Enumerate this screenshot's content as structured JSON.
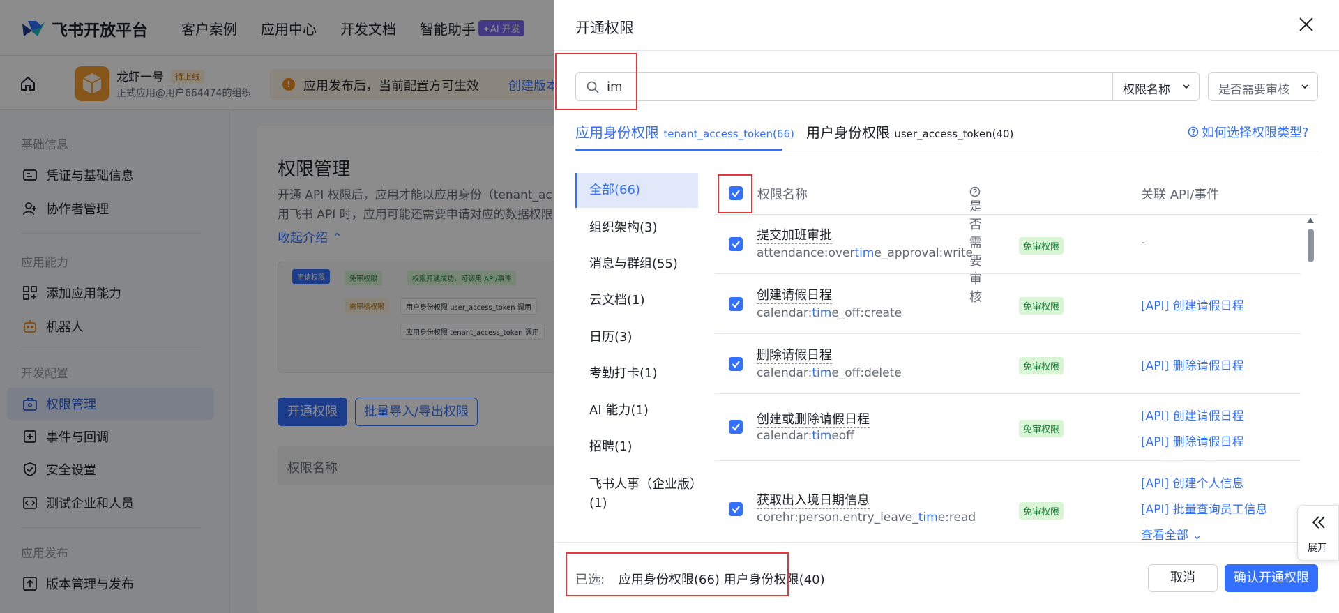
{
  "header": {
    "brand": "飞书开放平台",
    "nav": [
      "客户案例",
      "应用中心",
      "开发文档",
      "智能助手"
    ],
    "ai_badge": "✦AI 开发"
  },
  "app_bar": {
    "app_name": "龙虾一号",
    "status_tag": "待上线",
    "app_subtitle": "正式应用@用户664474的组织",
    "notice_text": "应用发布后，当前配置方可生效",
    "notice_link": "创建版本"
  },
  "sidebar": {
    "groups": [
      {
        "title": "基础信息",
        "items": [
          "凭证与基础信息",
          "协作者管理"
        ]
      },
      {
        "title": "应用能力",
        "items": [
          "添加应用能力",
          "机器人"
        ]
      },
      {
        "title": "开发配置",
        "items": [
          "权限管理",
          "事件与回调",
          "安全设置",
          "测试企业和人员"
        ]
      },
      {
        "title": "应用发布",
        "items": [
          "版本管理与发布"
        ]
      }
    ],
    "active_item": "权限管理"
  },
  "main": {
    "title": "权限管理",
    "desc_line1": "开通 API 权限后，应用才能以应用身份（tenant_ac",
    "desc_line2": "用飞书 API 时，应用可能还需要申请对应的数据权限",
    "collapse_link": "收起介绍",
    "flow": {
      "apply": "申请权限",
      "free": "免审权限",
      "success": "权限开通成功，可调用 API/事件",
      "review": "需审核权限",
      "user_identity": "用户身份权限 user_access_token 调用",
      "app_identity": "应用身份权限 tenant_access_token 调用"
    },
    "btn_open": "开通权限",
    "btn_bulk": "批量导入/导出权限",
    "table_header": "权限名称"
  },
  "drawer": {
    "title": "开通权限",
    "search_value": "im",
    "filter_name": "权限名称",
    "filter_review": "是否需要审核",
    "tabs": [
      {
        "label": "应用身份权限",
        "token": "tenant_access_token(66)",
        "active": true
      },
      {
        "label": "用户身份权限",
        "token": "user_access_token(40)",
        "active": false
      }
    ],
    "help_link": "如何选择权限类型?",
    "categories": [
      "全部(66)",
      "组织架构(3)",
      "消息与群组(55)",
      "云文档(1)",
      "日历(3)",
      "考勤打卡(1)",
      "AI 能力(1)",
      "招聘(1)",
      "飞书人事（企业版）(1)"
    ],
    "columns": {
      "name": "权限名称",
      "review": "是否需要审核",
      "api": "关联 API/事件"
    },
    "rows": [
      {
        "name": "提交加班审批",
        "key_pre": "attendance:over",
        "key_hl": "tim",
        "key_post": "e_approval:write",
        "badge": "免审权限",
        "apis": [],
        "dash": "-"
      },
      {
        "name": "创建请假日程",
        "key_pre": "calendar:",
        "key_hl": "tim",
        "key_post": "e_off:create",
        "badge": "免审权限",
        "apis": [
          "[API] 创建请假日程"
        ]
      },
      {
        "name": "删除请假日程",
        "key_pre": "calendar:",
        "key_hl": "tim",
        "key_post": "e_off:delete",
        "badge": "免审权限",
        "apis": [
          "[API] 删除请假日程"
        ]
      },
      {
        "name": "创建或删除请假日程",
        "key_pre": "calendar:",
        "key_hl": "tim",
        "key_post": "eoff",
        "badge": "免审权限",
        "apis": [
          "[API] 创建请假日程",
          "[API] 删除请假日程"
        ]
      },
      {
        "name": "获取出入境日期信息",
        "key_pre": "corehr:person.entry_leave_",
        "key_hl": "tim",
        "key_post": "e:read",
        "badge": "免审权限",
        "apis": [
          "[API] 创建个人信息",
          "[API] 批量查询员工信息"
        ],
        "more": "查看全部"
      }
    ],
    "footer": {
      "selected_label": "已选:",
      "selected_value": "应用身份权限(66)  用户身份权限(40)",
      "cancel": "取消",
      "confirm": "确认开通权限"
    }
  },
  "expand_button": "展开",
  "colors": {
    "primary": "#3370ff",
    "annotation": "#e8373b",
    "badge_bg": "#d9f5d6",
    "badge_fg": "#1e7c3a"
  }
}
